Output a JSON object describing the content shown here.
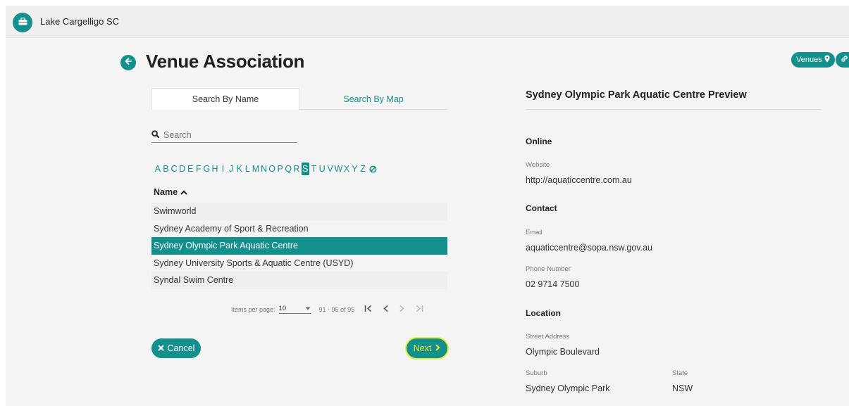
{
  "topbar": {
    "org_name": "Lake Cargelligo SC",
    "org_icon": "briefcase-icon"
  },
  "header": {
    "title": "Venue Association",
    "back_icon": "arrow-left-icon",
    "venues_pill": "Venues",
    "venues_pill_icon": "map-pin-icon",
    "other_pill_icon": "link-icon"
  },
  "tabs": [
    {
      "label": "Search By Name",
      "active": true
    },
    {
      "label": "Search By Map",
      "active": false
    }
  ],
  "search": {
    "placeholder": "Search",
    "value": "",
    "icon": "search-icon"
  },
  "alphabet": {
    "letters": [
      "A",
      "B",
      "C",
      "D",
      "E",
      "F",
      "G",
      "H",
      "I",
      "J",
      "K",
      "L",
      "M",
      "N",
      "O",
      "P",
      "Q",
      "R",
      "S",
      "T",
      "U",
      "V",
      "W",
      "X",
      "Y",
      "Z"
    ],
    "selected": "S",
    "clear_icon": "clear-filter-icon"
  },
  "list": {
    "header": "Name",
    "sort_icon": "chevron-up-icon",
    "rows": [
      "Swimworld",
      "Sydney Academy of Sport & Recreation",
      "Sydney Olympic Park Aquatic Centre",
      "Sydney University Sports & Aquatic Centre (USYD)",
      "Syndal Swim Centre"
    ],
    "selected_index": 2
  },
  "pager": {
    "items_label": "Items per page:",
    "page_size": "10",
    "range": "91 - 95 of 95"
  },
  "actions": {
    "cancel_label": "Cancel",
    "next_label": "Next"
  },
  "preview": {
    "title": "Sydney Olympic Park Aquatic Centre Preview",
    "online_heading": "Online",
    "website_label": "Website",
    "website": "http://aquaticcentre.com.au",
    "contact_heading": "Contact",
    "email_label": "Email",
    "email": "aquaticcentre@sopa.nsw.gov.au",
    "phone_label": "Phone Number",
    "phone": "02 9714 7500",
    "location_heading": "Location",
    "street_label": "Street Address",
    "street": "Olympic Boulevard",
    "suburb_label": "Suburb",
    "suburb": "Sydney Olympic Park",
    "state_label": "State",
    "state": "NSW"
  },
  "colors": {
    "accent": "#138f8c",
    "highlight": "#e8ef3a"
  }
}
